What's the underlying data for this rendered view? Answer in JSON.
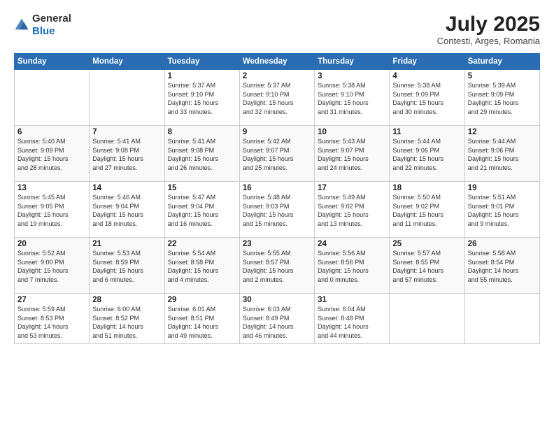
{
  "header": {
    "logo_general": "General",
    "logo_blue": "Blue",
    "month_year": "July 2025",
    "location": "Contesti, Arges, Romania"
  },
  "calendar": {
    "days_of_week": [
      "Sunday",
      "Monday",
      "Tuesday",
      "Wednesday",
      "Thursday",
      "Friday",
      "Saturday"
    ],
    "weeks": [
      [
        {
          "day": "",
          "info": ""
        },
        {
          "day": "",
          "info": ""
        },
        {
          "day": "1",
          "info": "Sunrise: 5:37 AM\nSunset: 9:10 PM\nDaylight: 15 hours\nand 33 minutes."
        },
        {
          "day": "2",
          "info": "Sunrise: 5:37 AM\nSunset: 9:10 PM\nDaylight: 15 hours\nand 32 minutes."
        },
        {
          "day": "3",
          "info": "Sunrise: 5:38 AM\nSunset: 9:10 PM\nDaylight: 15 hours\nand 31 minutes."
        },
        {
          "day": "4",
          "info": "Sunrise: 5:38 AM\nSunset: 9:09 PM\nDaylight: 15 hours\nand 30 minutes."
        },
        {
          "day": "5",
          "info": "Sunrise: 5:39 AM\nSunset: 9:09 PM\nDaylight: 15 hours\nand 29 minutes."
        }
      ],
      [
        {
          "day": "6",
          "info": "Sunrise: 5:40 AM\nSunset: 9:09 PM\nDaylight: 15 hours\nand 28 minutes."
        },
        {
          "day": "7",
          "info": "Sunrise: 5:41 AM\nSunset: 9:08 PM\nDaylight: 15 hours\nand 27 minutes."
        },
        {
          "day": "8",
          "info": "Sunrise: 5:41 AM\nSunset: 9:08 PM\nDaylight: 15 hours\nand 26 minutes."
        },
        {
          "day": "9",
          "info": "Sunrise: 5:42 AM\nSunset: 9:07 PM\nDaylight: 15 hours\nand 25 minutes."
        },
        {
          "day": "10",
          "info": "Sunrise: 5:43 AM\nSunset: 9:07 PM\nDaylight: 15 hours\nand 24 minutes."
        },
        {
          "day": "11",
          "info": "Sunrise: 5:44 AM\nSunset: 9:06 PM\nDaylight: 15 hours\nand 22 minutes."
        },
        {
          "day": "12",
          "info": "Sunrise: 5:44 AM\nSunset: 9:06 PM\nDaylight: 15 hours\nand 21 minutes."
        }
      ],
      [
        {
          "day": "13",
          "info": "Sunrise: 5:45 AM\nSunset: 9:05 PM\nDaylight: 15 hours\nand 19 minutes."
        },
        {
          "day": "14",
          "info": "Sunrise: 5:46 AM\nSunset: 9:04 PM\nDaylight: 15 hours\nand 18 minutes."
        },
        {
          "day": "15",
          "info": "Sunrise: 5:47 AM\nSunset: 9:04 PM\nDaylight: 15 hours\nand 16 minutes."
        },
        {
          "day": "16",
          "info": "Sunrise: 5:48 AM\nSunset: 9:03 PM\nDaylight: 15 hours\nand 15 minutes."
        },
        {
          "day": "17",
          "info": "Sunrise: 5:49 AM\nSunset: 9:02 PM\nDaylight: 15 hours\nand 13 minutes."
        },
        {
          "day": "18",
          "info": "Sunrise: 5:50 AM\nSunset: 9:02 PM\nDaylight: 15 hours\nand 11 minutes."
        },
        {
          "day": "19",
          "info": "Sunrise: 5:51 AM\nSunset: 9:01 PM\nDaylight: 15 hours\nand 9 minutes."
        }
      ],
      [
        {
          "day": "20",
          "info": "Sunrise: 5:52 AM\nSunset: 9:00 PM\nDaylight: 15 hours\nand 7 minutes."
        },
        {
          "day": "21",
          "info": "Sunrise: 5:53 AM\nSunset: 8:59 PM\nDaylight: 15 hours\nand 6 minutes."
        },
        {
          "day": "22",
          "info": "Sunrise: 5:54 AM\nSunset: 8:58 PM\nDaylight: 15 hours\nand 4 minutes."
        },
        {
          "day": "23",
          "info": "Sunrise: 5:55 AM\nSunset: 8:57 PM\nDaylight: 15 hours\nand 2 minutes."
        },
        {
          "day": "24",
          "info": "Sunrise: 5:56 AM\nSunset: 8:56 PM\nDaylight: 15 hours\nand 0 minutes."
        },
        {
          "day": "25",
          "info": "Sunrise: 5:57 AM\nSunset: 8:55 PM\nDaylight: 14 hours\nand 57 minutes."
        },
        {
          "day": "26",
          "info": "Sunrise: 5:58 AM\nSunset: 8:54 PM\nDaylight: 14 hours\nand 55 minutes."
        }
      ],
      [
        {
          "day": "27",
          "info": "Sunrise: 5:59 AM\nSunset: 8:53 PM\nDaylight: 14 hours\nand 53 minutes."
        },
        {
          "day": "28",
          "info": "Sunrise: 6:00 AM\nSunset: 8:52 PM\nDaylight: 14 hours\nand 51 minutes."
        },
        {
          "day": "29",
          "info": "Sunrise: 6:01 AM\nSunset: 8:51 PM\nDaylight: 14 hours\nand 49 minutes."
        },
        {
          "day": "30",
          "info": "Sunrise: 6:03 AM\nSunset: 8:49 PM\nDaylight: 14 hours\nand 46 minutes."
        },
        {
          "day": "31",
          "info": "Sunrise: 6:04 AM\nSunset: 8:48 PM\nDaylight: 14 hours\nand 44 minutes."
        },
        {
          "day": "",
          "info": ""
        },
        {
          "day": "",
          "info": ""
        }
      ]
    ]
  }
}
